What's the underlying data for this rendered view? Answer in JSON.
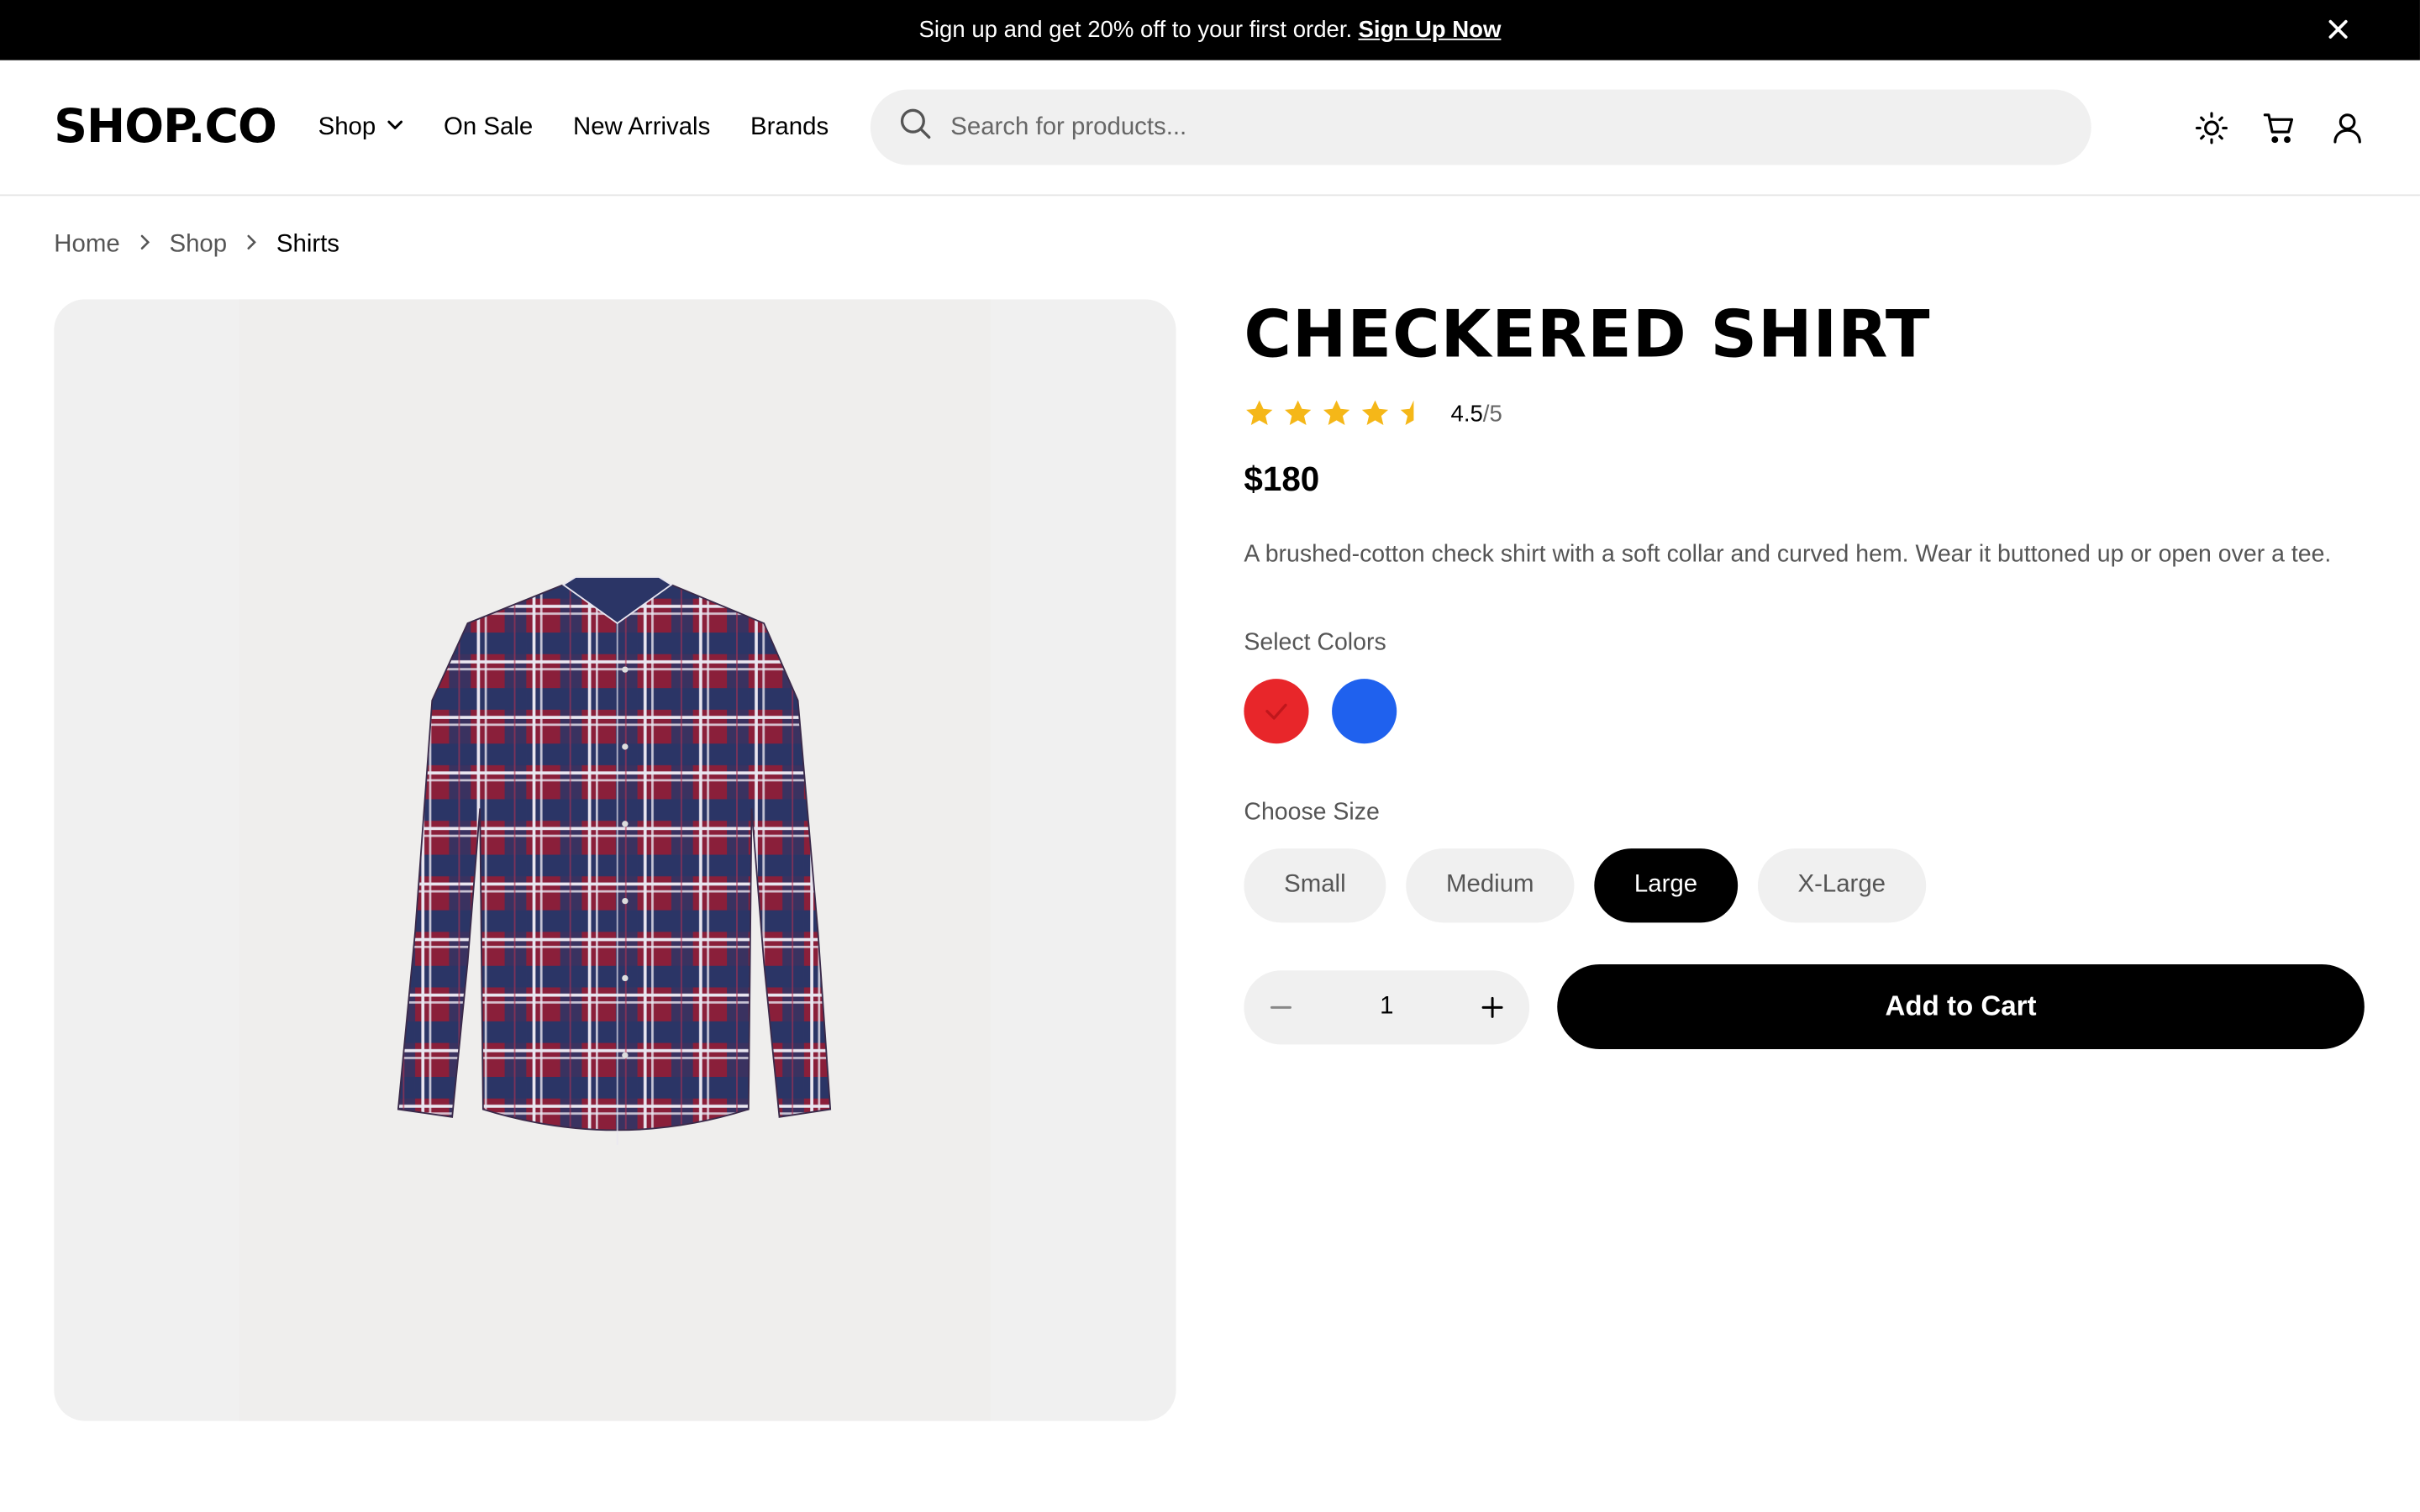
{
  "promo": {
    "text": "Sign up and get 20% off to your first order.",
    "link": "Sign Up Now"
  },
  "header": {
    "logo": "SHOP.CO",
    "nav": [
      "Shop",
      "On Sale",
      "New Arrivals",
      "Brands"
    ],
    "search_placeholder": "Search for products...",
    "icons": [
      "theme-sun-icon",
      "cart-icon",
      "account-icon"
    ]
  },
  "breadcrumb": [
    "Home",
    "Shop",
    "Shirts"
  ],
  "product": {
    "title": "CHECKERED SHIRT",
    "rating": "4.5",
    "rating_max": "/5",
    "rating_value": 4.5,
    "price": "$180",
    "description": "A brushed-cotton check shirt with a soft collar and curved hem. Wear it buttoned up or open over a tee.",
    "colors_label": "Select Colors",
    "colors": [
      {
        "name": "red",
        "hex": "#e8262a",
        "selected": true
      },
      {
        "name": "blue",
        "hex": "#1f61ee",
        "selected": false
      }
    ],
    "size_label": "Choose Size",
    "sizes": [
      {
        "label": "Small",
        "active": false
      },
      {
        "label": "Medium",
        "active": false
      },
      {
        "label": "Large",
        "active": true
      },
      {
        "label": "X-Large",
        "active": false
      }
    ],
    "quantity": "1",
    "add_to_cart": "Add to Cart"
  },
  "colors": {
    "star": "#f5b718",
    "accent": "#000000",
    "chip": "#f0f0f0"
  }
}
